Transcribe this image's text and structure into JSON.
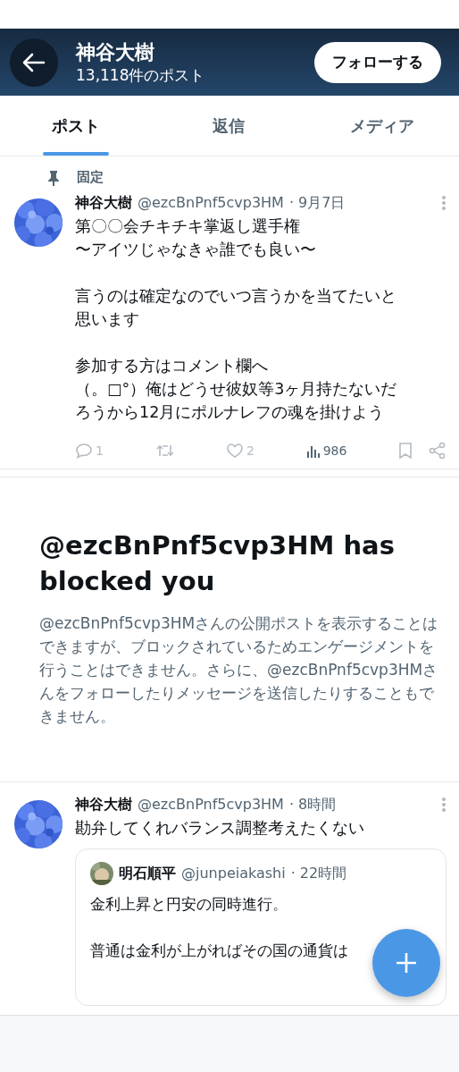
{
  "header": {
    "title": "神谷大樹",
    "subtitle": "13,118件のポスト",
    "follow_button": "フォローする"
  },
  "tabs": [
    {
      "label": "ポスト",
      "selected": true
    },
    {
      "label": "返信",
      "selected": false
    },
    {
      "label": "メディア",
      "selected": false
    }
  ],
  "pinned_label": "固定",
  "posts": [
    {
      "kind": "pinned",
      "name": "神谷大樹",
      "handle": "@ezcBnPnf5cvp3HM",
      "time": "· 9月7日",
      "paragraphs": [
        [
          "第〇〇会チキチキ掌返し選手権",
          "〜アイツじゃなきゃ誰でも良い〜"
        ],
        [
          "言うのは確定なのでいつ言うかを当てたいと",
          "思います"
        ],
        [
          "参加する方はコメント欄へ",
          "（。□°）俺はどうせ彼奴等3ヶ月持たないだ",
          "ろうから12月にポルナレフの魂を掛けよう"
        ]
      ],
      "replies": "1",
      "likes": "2",
      "views": "986"
    }
  ],
  "blocked_notice": {
    "title": "@ezcBnPnf5cvp3HM has blocked you",
    "body": "@ezcBnPnf5cvp3HMさんの公開ポストを表示することはできますが、ブロックされているためエンゲージメントを行うことはできません。さらに、@ezcBnPnf5cvp3HMさんをフォローしたりメッセージを送信したりすることもできません。"
  },
  "quote_post": {
    "name": "神谷大樹",
    "handle": "@ezcBnPnf5cvp3HM",
    "time": "· 8時間",
    "text": "勘弁してくれバランス調整考えたくない",
    "quoted": {
      "name": "明石順平",
      "handle": "@junpeiakashi",
      "time": "· 22時間",
      "paragraphs": [
        "金利上昇と円安の同時進行。",
        "普通は金利が上がればその国の通貨は"
      ]
    }
  }
}
